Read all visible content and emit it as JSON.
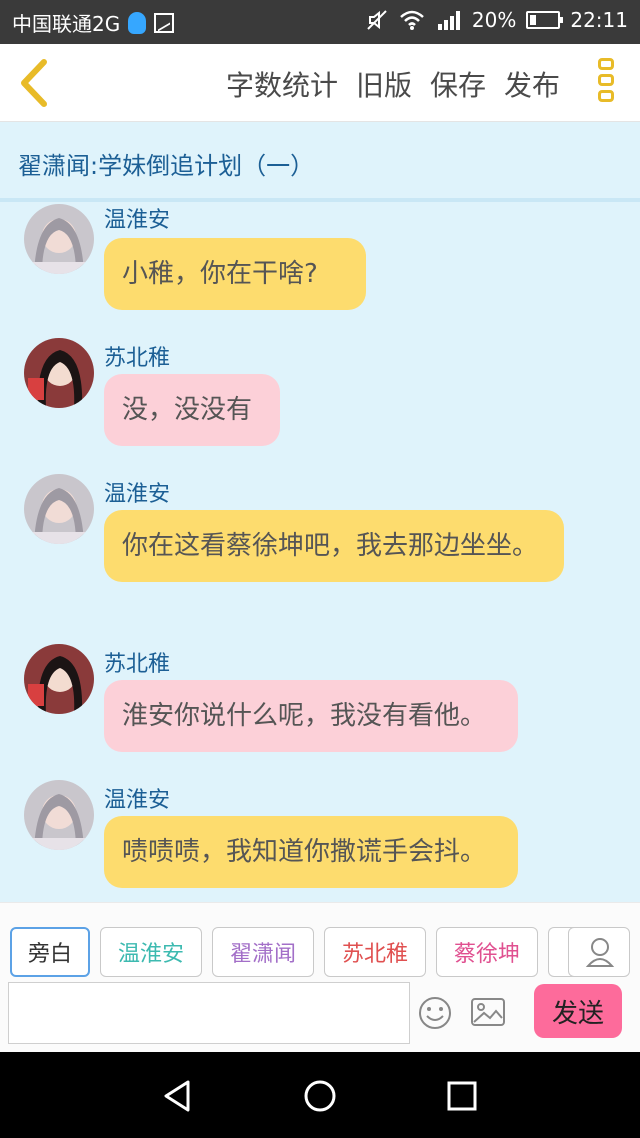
{
  "status_bar": {
    "carrier": "中国联通2G",
    "battery": "20%",
    "time": "22:11"
  },
  "top_nav": {
    "actions": [
      "字数统计",
      "旧版",
      "保存",
      "发布"
    ]
  },
  "chat": {
    "title": "翟潇闻:学妹倒追计划（一）",
    "messages": [
      {
        "name": "温淮安",
        "text": "小稚，你在干啥?",
        "color": "yellow",
        "avatar": "girl-gray"
      },
      {
        "name": "苏北稚",
        "text": "没，没没有",
        "color": "pink",
        "avatar": "girl-dark"
      },
      {
        "name": "温淮安",
        "text": "你在这看蔡徐坤吧，我去那边坐坐。",
        "color": "yellow",
        "avatar": "girl-gray"
      },
      {
        "name": "苏北稚",
        "text": "淮安你说什么呢，我没有看他。",
        "color": "pink",
        "avatar": "girl-dark"
      },
      {
        "name": "温淮安",
        "text": "啧啧啧，我知道你撒谎手会抖。",
        "color": "yellow",
        "avatar": "girl-gray"
      }
    ]
  },
  "roles": [
    {
      "label": "旁白",
      "color": "#333333"
    },
    {
      "label": "温淮安",
      "color": "#3dbab0"
    },
    {
      "label": "翟潇闻",
      "color": "#a36fc8"
    },
    {
      "label": "苏北稚",
      "color": "#e05050"
    },
    {
      "label": "蔡徐坤",
      "color": "#e05090"
    }
  ],
  "input": {
    "value": "",
    "send_label": "发送"
  },
  "colors": {
    "bubble_yellow": "#fddc6e",
    "bubble_pink": "#fcd0d8",
    "send": "#fd6b9b",
    "accent": "#e8bb28",
    "chat_bg": "#dff3fb"
  }
}
